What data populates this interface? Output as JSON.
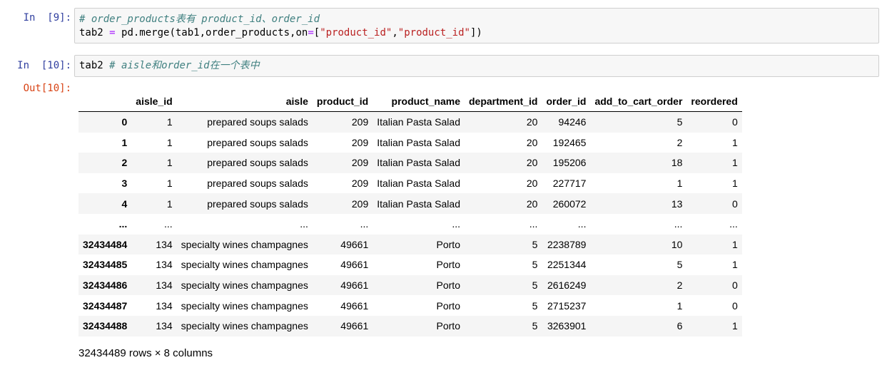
{
  "cell9": {
    "prompt": "In  [9]:",
    "line1_comment": "# order_products表有 product_id、order_id",
    "line2_a": "tab2 ",
    "line2_eq": "=",
    "line2_b": " pd.merge(tab1,order_products,on",
    "line2_eq2": "=",
    "line2_c": "[",
    "line2_s1": "\"product_id\"",
    "line2_comma": ",",
    "line2_s2": "\"product_id\"",
    "line2_d": "])"
  },
  "cell10": {
    "prompt": "In  [10]:",
    "code": "tab2 ",
    "comment": "# aisle和order_id在一个表中",
    "out_prompt": "Out[10]:"
  },
  "dataframe": {
    "columns": [
      "",
      "aisle_id",
      "aisle",
      "product_id",
      "product_name",
      "department_id",
      "order_id",
      "add_to_cart_order",
      "reordered"
    ],
    "rows": [
      [
        "0",
        "1",
        "prepared soups salads",
        "209",
        "Italian Pasta Salad",
        "20",
        "94246",
        "5",
        "0"
      ],
      [
        "1",
        "1",
        "prepared soups salads",
        "209",
        "Italian Pasta Salad",
        "20",
        "192465",
        "2",
        "1"
      ],
      [
        "2",
        "1",
        "prepared soups salads",
        "209",
        "Italian Pasta Salad",
        "20",
        "195206",
        "18",
        "1"
      ],
      [
        "3",
        "1",
        "prepared soups salads",
        "209",
        "Italian Pasta Salad",
        "20",
        "227717",
        "1",
        "1"
      ],
      [
        "4",
        "1",
        "prepared soups salads",
        "209",
        "Italian Pasta Salad",
        "20",
        "260072",
        "13",
        "0"
      ],
      [
        "...",
        "...",
        "...",
        "...",
        "...",
        "...",
        "...",
        "...",
        "..."
      ],
      [
        "32434484",
        "134",
        "specialty wines champagnes",
        "49661",
        "Porto",
        "5",
        "2238789",
        "10",
        "1"
      ],
      [
        "32434485",
        "134",
        "specialty wines champagnes",
        "49661",
        "Porto",
        "5",
        "2251344",
        "5",
        "1"
      ],
      [
        "32434486",
        "134",
        "specialty wines champagnes",
        "49661",
        "Porto",
        "5",
        "2616249",
        "2",
        "0"
      ],
      [
        "32434487",
        "134",
        "specialty wines champagnes",
        "49661",
        "Porto",
        "5",
        "2715237",
        "1",
        "0"
      ],
      [
        "32434488",
        "134",
        "specialty wines champagnes",
        "49661",
        "Porto",
        "5",
        "3263901",
        "6",
        "1"
      ]
    ],
    "shape_text": "32434489 rows × 8 columns"
  }
}
